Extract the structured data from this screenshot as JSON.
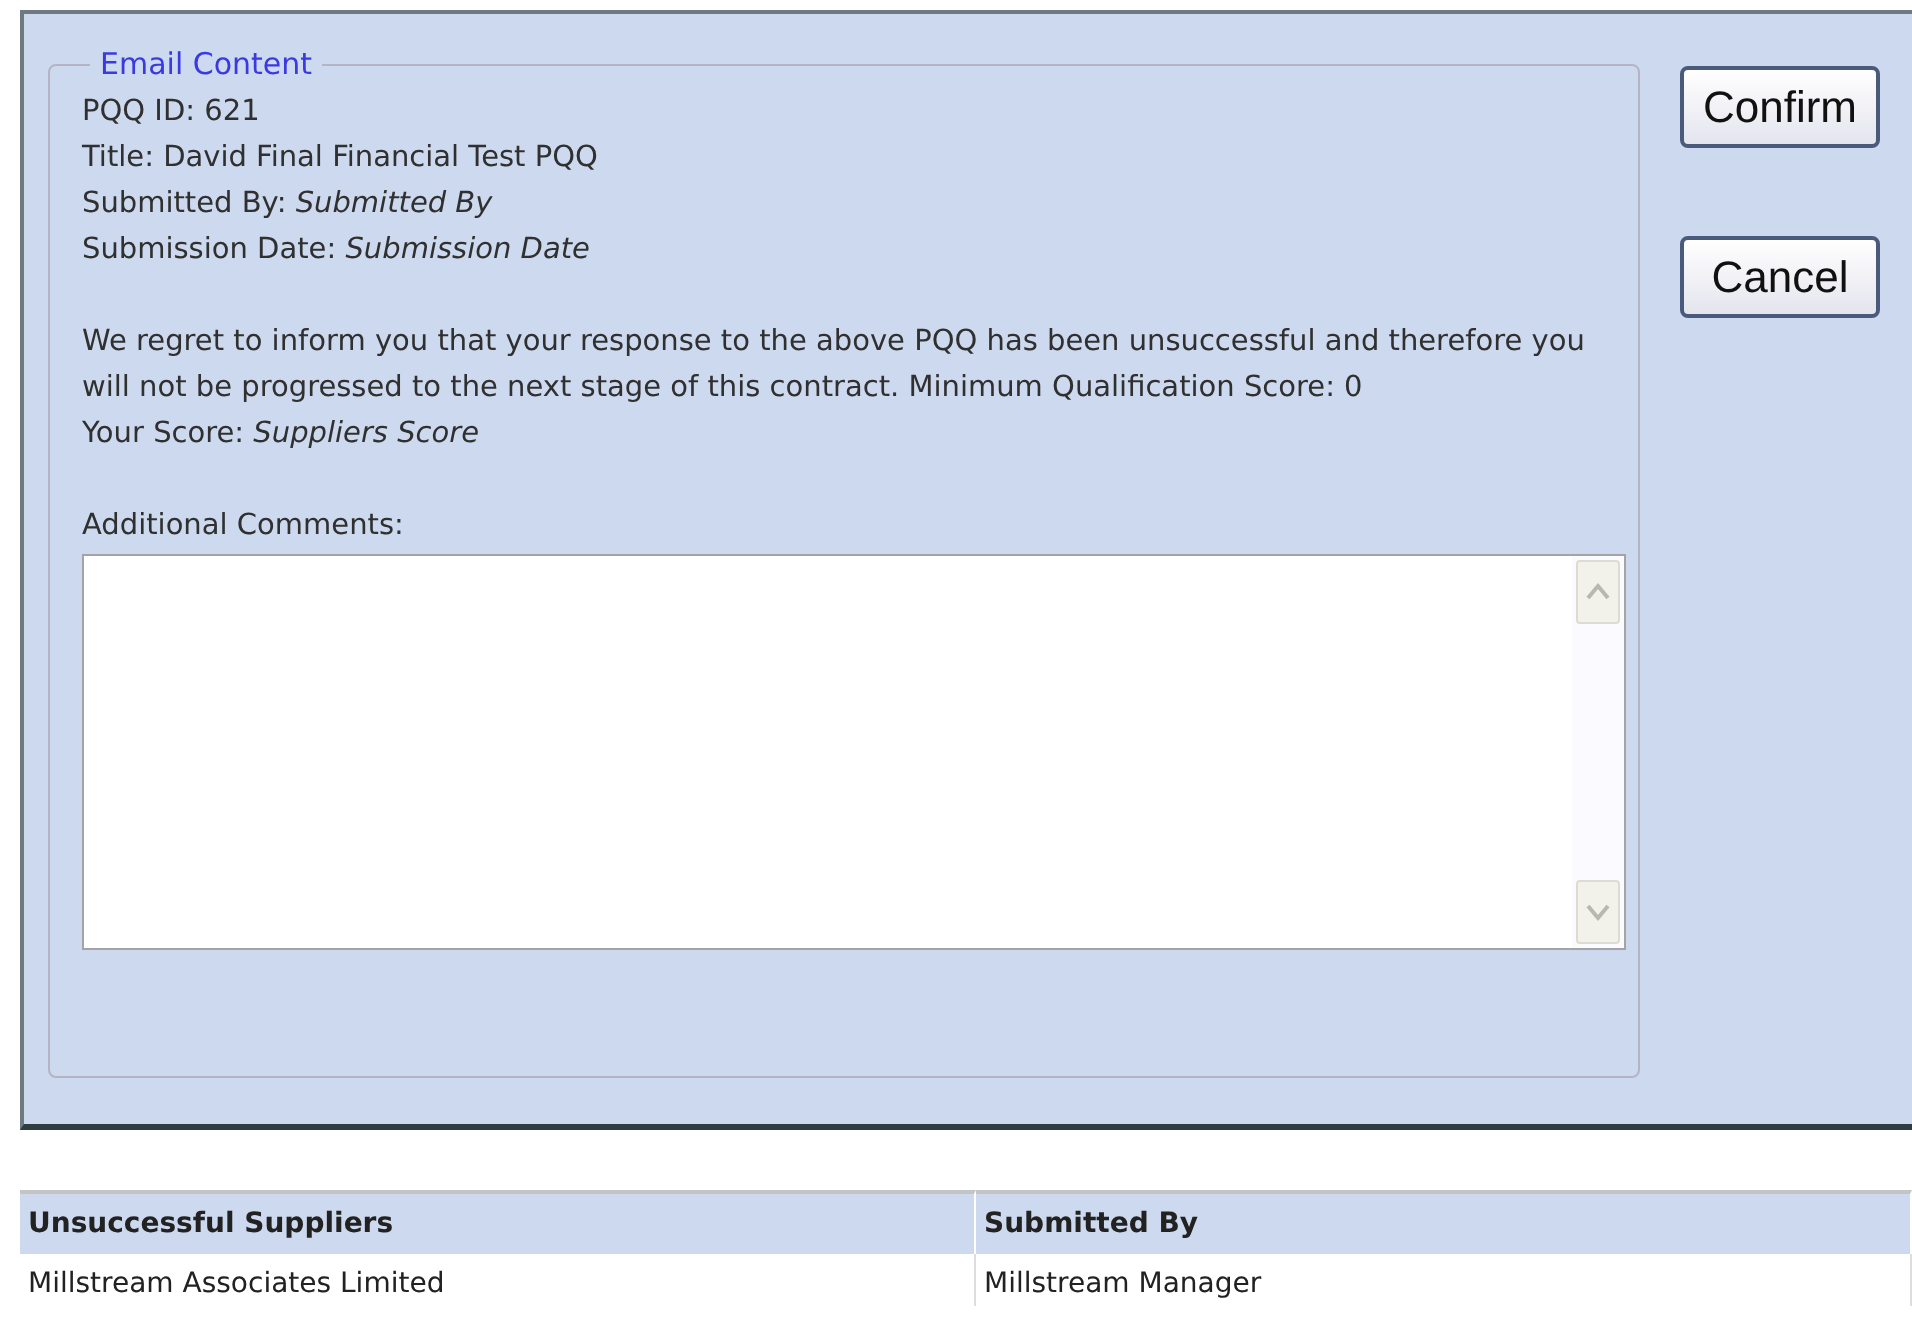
{
  "email_content": {
    "legend": "Email Content",
    "details": [
      "PQQ ID: 621",
      "Title: David Final Financial Test PQQ",
      "Submitted By: *Submitted By*",
      "Submission Date: *Submission Date*"
    ],
    "message": [
      "We regret to inform you that your response to the above PQQ has been unsuccessful and therefore you will not be progressed to the next stage of this contract. Minimum Qualification Score: 0",
      "Your Score: *Suppliers Score*"
    ],
    "comments_label": "Additional Comments:"
  },
  "buttons": [
    "Confirm",
    "Cancel"
  ],
  "table": {
    "columns": [
      "Unsuccessful Suppliers",
      "Submitted By"
    ],
    "rows": [
      [
        "Millstream Associates Limited",
        "Millstream Manager"
      ]
    ]
  }
}
